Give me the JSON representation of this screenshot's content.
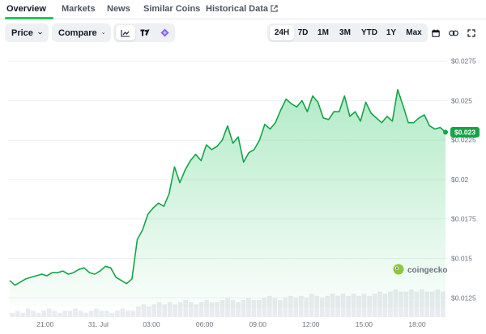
{
  "tabs": [
    {
      "label": "Overview",
      "active": true
    },
    {
      "label": "Markets"
    },
    {
      "label": "News"
    },
    {
      "label": "Similar Coins"
    },
    {
      "label": "Historical Data"
    }
  ],
  "toolbar": {
    "price_label": "Price",
    "compare_label": "Compare",
    "chart_type_icons": [
      "line-chart-icon",
      "tradingview-icon",
      "diamond-icon"
    ],
    "ranges": [
      "24H",
      "7D",
      "1M",
      "3M",
      "YTD",
      "1Y",
      "Max"
    ],
    "active_range": "24H",
    "extra_icons": [
      "calendar-icon",
      "link-icon",
      "expand-icon"
    ]
  },
  "watermark": "coingecko",
  "colors": {
    "line": "#16a34a",
    "fill": "#22c55e",
    "accent": "#22c55e",
    "price_badge_bg": "#16a34a",
    "price_badge_text": "#ffffff"
  },
  "chart_data": {
    "type": "area",
    "title": "",
    "xlabel": "",
    "ylabel": "",
    "ylim": [
      0.0119,
      0.0282
    ],
    "y_ticks": [
      "$0.0275",
      "$0.025",
      "$0.0225",
      "$0.02",
      "$0.0175",
      "$0.015",
      "$0.0125"
    ],
    "x_ticks": [
      "21:00",
      "31. Jul",
      "03:00",
      "06:00",
      "09:00",
      "12:00",
      "15:00",
      "18:00"
    ],
    "current_price_label": "$0.023",
    "grid": true,
    "legend": "none",
    "series": [
      {
        "x": [
          0.0,
          0.3,
          0.6,
          0.9,
          1.2,
          1.5,
          1.8,
          2.1,
          2.4,
          2.7,
          3.0,
          3.3,
          3.6,
          3.9,
          4.2,
          4.5,
          4.8,
          5.1,
          5.4,
          5.7,
          6.0,
          6.3,
          6.6,
          6.9,
          7.2,
          7.5,
          7.8,
          8.1,
          8.4,
          8.7,
          9.0,
          9.3,
          9.6,
          9.9,
          10.2,
          10.5,
          10.8,
          11.1,
          11.4,
          11.7,
          12.0,
          12.3,
          12.6,
          12.9,
          13.2,
          13.5,
          13.8,
          14.1,
          14.4,
          14.7,
          15.0,
          15.3,
          15.6,
          15.9,
          16.2,
          16.5,
          16.8,
          17.1,
          17.4,
          17.7,
          18.0,
          18.3,
          18.6,
          18.9,
          19.2,
          19.5,
          19.8,
          20.1,
          20.4,
          20.7,
          21.0,
          21.3,
          21.6,
          21.9,
          22.2,
          22.5,
          22.8,
          23.1,
          23.4,
          23.7,
          24.0,
          24.3,
          24.6
        ],
        "values": [
          0.0136,
          0.0133,
          0.0135,
          0.0137,
          0.0138,
          0.0139,
          0.014,
          0.0139,
          0.0141,
          0.0141,
          0.0142,
          0.014,
          0.0141,
          0.0143,
          0.0144,
          0.0141,
          0.014,
          0.0142,
          0.0145,
          0.0144,
          0.0138,
          0.0136,
          0.0134,
          0.0137,
          0.0162,
          0.0168,
          0.0178,
          0.0182,
          0.0185,
          0.0183,
          0.0191,
          0.0208,
          0.0198,
          0.0206,
          0.0212,
          0.0216,
          0.0212,
          0.0222,
          0.0219,
          0.0221,
          0.0225,
          0.0234,
          0.0223,
          0.0227,
          0.0211,
          0.0217,
          0.0219,
          0.0225,
          0.0235,
          0.0232,
          0.0236,
          0.0244,
          0.0251,
          0.0248,
          0.0246,
          0.025,
          0.0243,
          0.0253,
          0.0249,
          0.0239,
          0.0238,
          0.0243,
          0.0243,
          0.0253,
          0.024,
          0.0243,
          0.0237,
          0.0249,
          0.0242,
          0.0239,
          0.0236,
          0.024,
          0.0237,
          0.0257,
          0.0247,
          0.0236,
          0.0236,
          0.0239,
          0.0241,
          0.0234,
          0.0232,
          0.0233,
          0.023
        ]
      }
    ],
    "volume": [
      2,
      3,
      2,
      4,
      3,
      2,
      3,
      4,
      3,
      2,
      3,
      3,
      4,
      3,
      2,
      3,
      4,
      3,
      3,
      2,
      3,
      4,
      3,
      3,
      5,
      6,
      5,
      6,
      7,
      6,
      7,
      6,
      7,
      8,
      7,
      6,
      7,
      8,
      7,
      7,
      8,
      9,
      8,
      7,
      8,
      9,
      8,
      8,
      9,
      10,
      9,
      8,
      9,
      10,
      9,
      10,
      9,
      11,
      10,
      9,
      10,
      11,
      10,
      11,
      10,
      11,
      10,
      11,
      10,
      11,
      12,
      11,
      12,
      13,
      12,
      12,
      13,
      12,
      13,
      12,
      12,
      13,
      12
    ]
  }
}
